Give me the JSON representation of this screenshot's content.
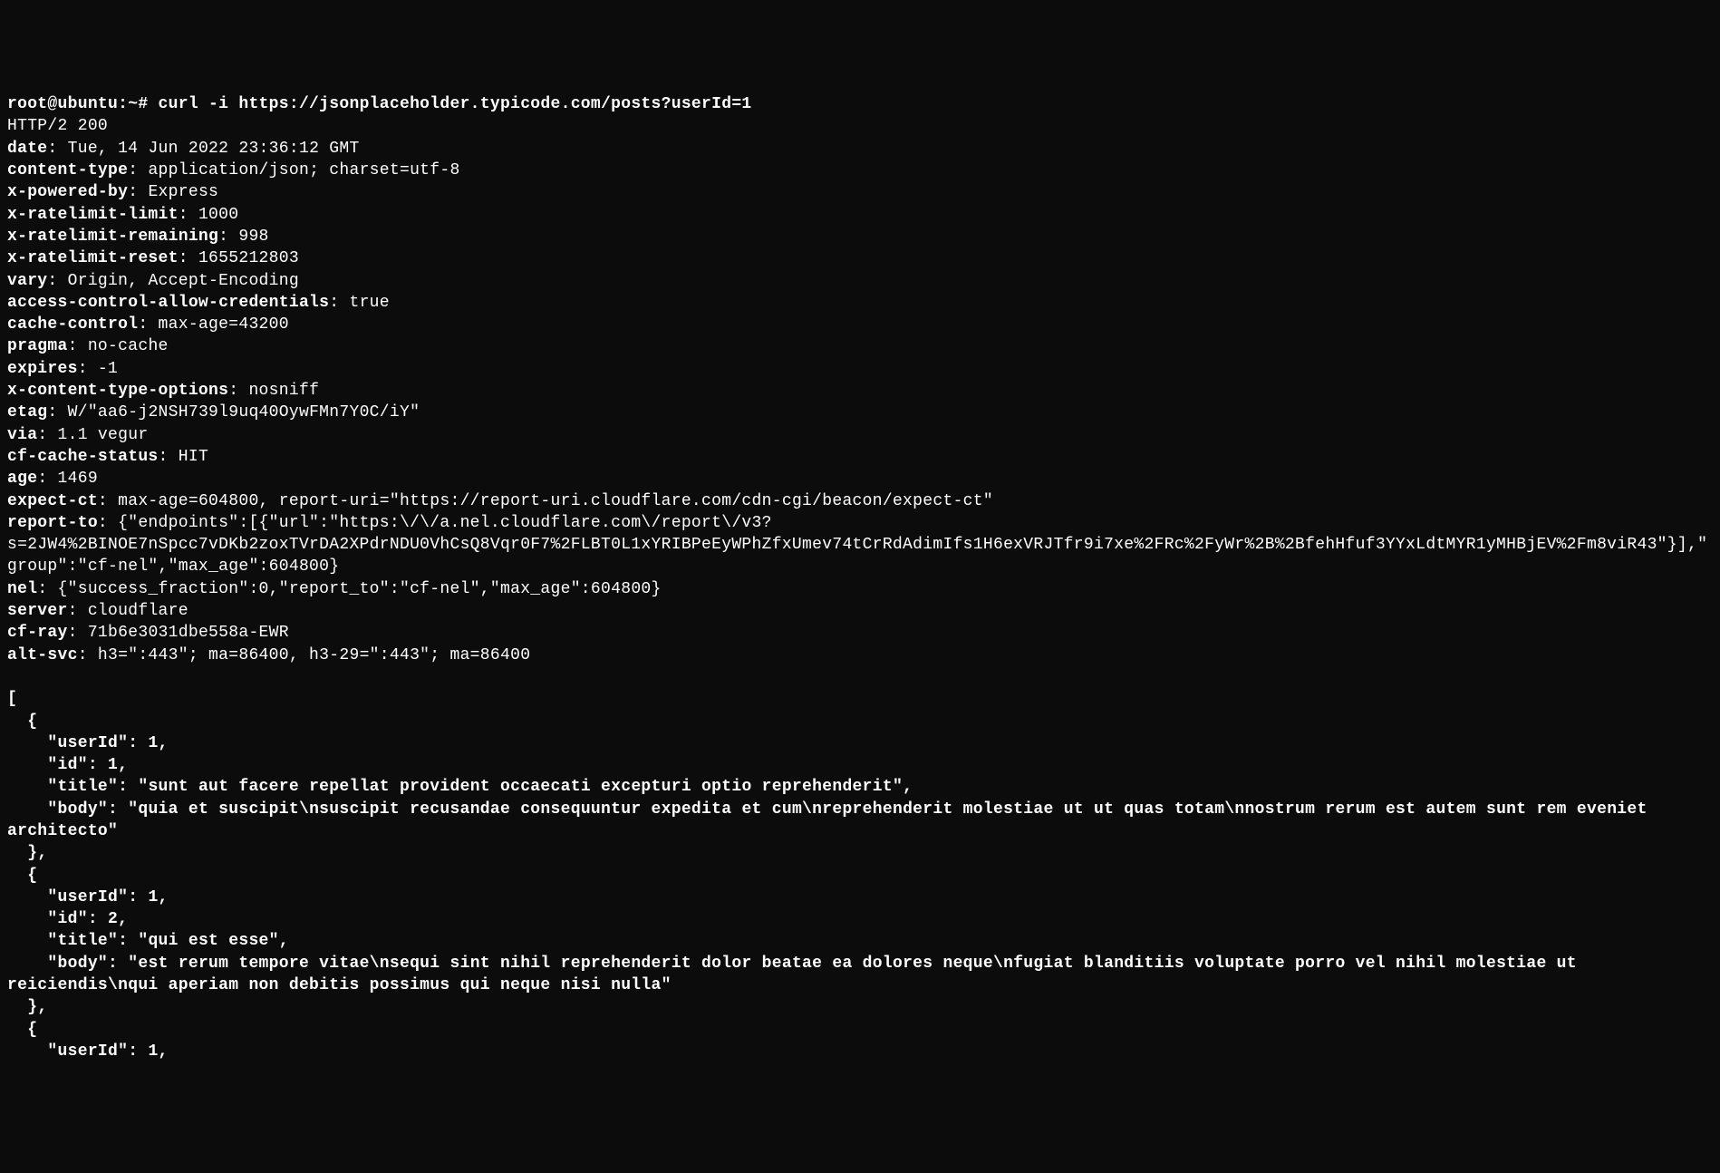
{
  "prompt_prefix": "root@ubuntu:~# ",
  "command": "curl -i https://jsonplaceholder.typicode.com/posts?userId=1",
  "status_line": "HTTP/2 200",
  "headers": [
    {
      "k": "date",
      "v": ": Tue, 14 Jun 2022 23:36:12 GMT"
    },
    {
      "k": "content-type",
      "v": ": application/json; charset=utf-8"
    },
    {
      "k": "x-powered-by",
      "v": ": Express"
    },
    {
      "k": "x-ratelimit-limit",
      "v": ": 1000"
    },
    {
      "k": "x-ratelimit-remaining",
      "v": ": 998"
    },
    {
      "k": "x-ratelimit-reset",
      "v": ": 1655212803"
    },
    {
      "k": "vary",
      "v": ": Origin, Accept-Encoding"
    },
    {
      "k": "access-control-allow-credentials",
      "v": ": true"
    },
    {
      "k": "cache-control",
      "v": ": max-age=43200"
    },
    {
      "k": "pragma",
      "v": ": no-cache"
    },
    {
      "k": "expires",
      "v": ": -1"
    },
    {
      "k": "x-content-type-options",
      "v": ": nosniff"
    },
    {
      "k": "etag",
      "v": ": W/\"aa6-j2NSH739l9uq40OywFMn7Y0C/iY\""
    },
    {
      "k": "via",
      "v": ": 1.1 vegur"
    },
    {
      "k": "cf-cache-status",
      "v": ": HIT"
    },
    {
      "k": "age",
      "v": ": 1469"
    },
    {
      "k": "expect-ct",
      "v": ": max-age=604800, report-uri=\"https://report-uri.cloudflare.com/cdn-cgi/beacon/expect-ct\""
    },
    {
      "k": "report-to",
      "v": ": {\"endpoints\":[{\"url\":\"https:\\/\\/a.nel.cloudflare.com\\/report\\/v3?s=2JW4%2BINOE7nSpcc7vDKb2zoxTVrDA2XPdrNDU0VhCsQ8Vqr0F7%2FLBT0L1xYRIBPeEyWPhZfxUmev74tCrRdAdimIfs1H6exVRJTfr9i7xe%2FRc%2FyWr%2B%2BfehHfuf3YYxLdtMYR1yMHBjEV%2Fm8viR43\"}],\"group\":\"cf-nel\",\"max_age\":604800}"
    },
    {
      "k": "nel",
      "v": ": {\"success_fraction\":0,\"report_to\":\"cf-nel\",\"max_age\":604800}"
    },
    {
      "k": "server",
      "v": ": cloudflare"
    },
    {
      "k": "cf-ray",
      "v": ": 71b6e3031dbe558a-EWR"
    },
    {
      "k": "alt-svc",
      "v": ": h3=\":443\"; ma=86400, h3-29=\":443\"; ma=86400"
    }
  ],
  "response_body": "[\n  {\n    \"userId\": 1,\n    \"id\": 1,\n    \"title\": \"sunt aut facere repellat provident occaecati excepturi optio reprehenderit\",\n    \"body\": \"quia et suscipit\\nsuscipit recusandae consequuntur expedita et cum\\nreprehenderit molestiae ut ut quas totam\\nnostrum rerum est autem sunt rem eveniet architecto\"\n  },\n  {\n    \"userId\": 1,\n    \"id\": 2,\n    \"title\": \"qui est esse\",\n    \"body\": \"est rerum tempore vitae\\nsequi sint nihil reprehenderit dolor beatae ea dolores neque\\nfugiat blanditiis voluptate porro vel nihil molestiae ut reiciendis\\nqui aperiam non debitis possimus qui neque nisi nulla\"\n  },\n  {\n    \"userId\": 1,"
}
